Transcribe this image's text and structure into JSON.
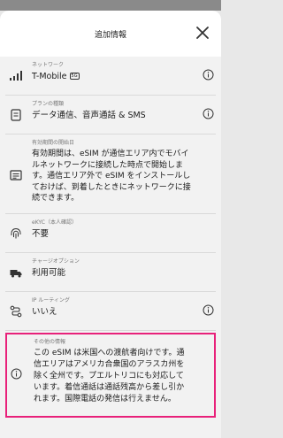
{
  "header": {
    "title": "追加情報"
  },
  "rows": {
    "network": {
      "label": "ネットワーク",
      "value": "T-Mobile",
      "badge": "5G"
    },
    "plan": {
      "label": "プランの種類",
      "value": "データ通信、音声通話 & SMS"
    },
    "validity": {
      "label": "有効期間の開始日",
      "value": "有効期間は、eSIM が通信エリア内でモバイルネットワークに接続した時点で開始します。通信エリア外で eSIM をインストールしておけば、到着したときにネットワークに接続できます。"
    },
    "ekyc": {
      "label": "eKYC（本人確認）",
      "value": "不要"
    },
    "topup": {
      "label": "チャージオプション",
      "value": "利用可能"
    },
    "routing": {
      "label": "IP ルーティング",
      "value": "いいえ"
    },
    "other": {
      "label": "その他の情報",
      "value": "この eSIM は米国への渡航者向けです。通信エリアはアメリカ合衆国のアラスカ州を除く全州です。プエルトリコにも対応しています。着信通話は通話残高から差し引かれます。国際電話の発信は行えません。"
    }
  },
  "colors": {
    "highlight": "#e8217a"
  }
}
